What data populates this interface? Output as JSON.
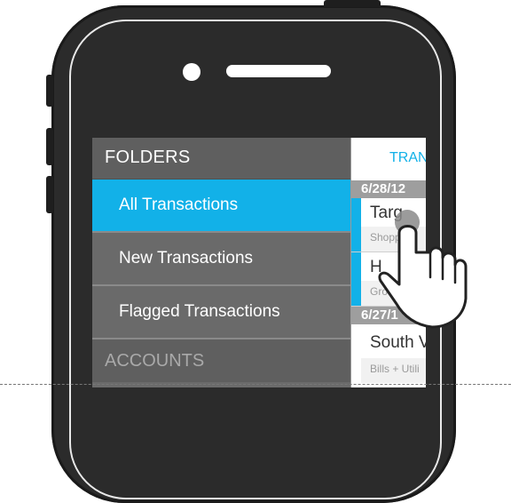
{
  "sidebar": {
    "header": "FOLDERS",
    "items": [
      {
        "label": "All Transactions",
        "active": true
      },
      {
        "label": "New Transactions",
        "active": false
      },
      {
        "label": "Flagged Transactions",
        "active": false
      }
    ],
    "section": "ACCOUNTS"
  },
  "panel": {
    "title": "TRAN",
    "groups": [
      {
        "date": "6/28/12",
        "transactions": [
          {
            "name": "Targ",
            "category": "Shopp"
          },
          {
            "name": "H",
            "category": "Groc"
          }
        ]
      },
      {
        "date": "6/27/1",
        "transactions": [
          {
            "name": "South V",
            "category": "Bills + Utili"
          }
        ]
      }
    ]
  },
  "colors": {
    "accent": "#12b1e8",
    "phone_body": "#2b2b2b",
    "sidebar_bg": "#6b6b6b"
  },
  "icons": {
    "pointer": "hand-pointer-icon"
  }
}
